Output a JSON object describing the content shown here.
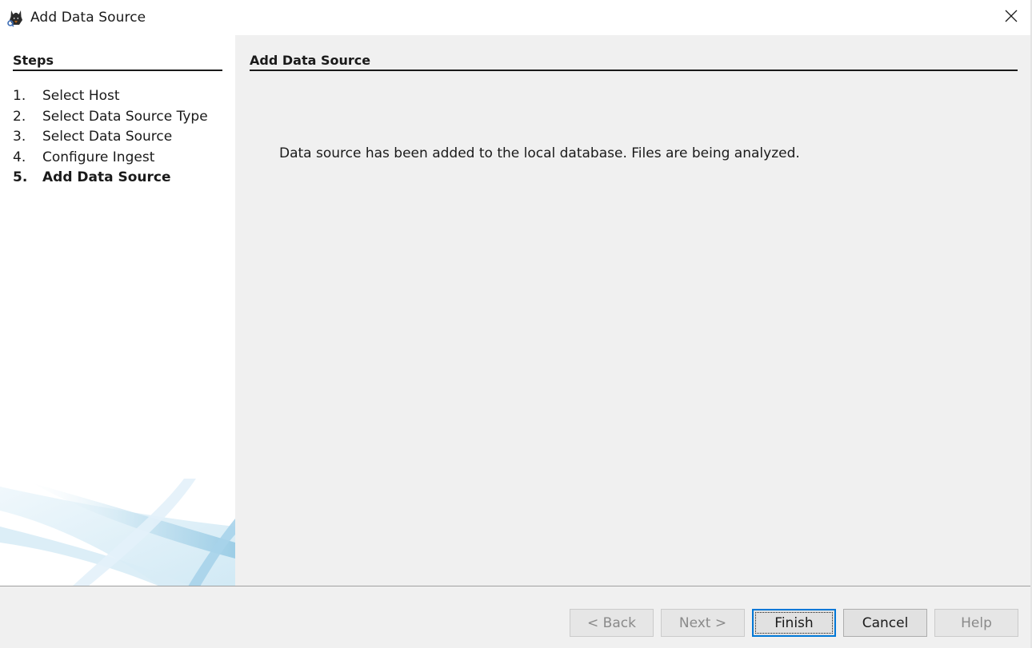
{
  "window": {
    "title": "Add Data Source",
    "icon": "autopsy-dog-icon"
  },
  "steps": {
    "header": "Steps",
    "items": [
      {
        "num": "1.",
        "label": "Select Host",
        "active": false
      },
      {
        "num": "2.",
        "label": "Select Data Source Type",
        "active": false
      },
      {
        "num": "3.",
        "label": "Select Data Source",
        "active": false
      },
      {
        "num": "4.",
        "label": "Configure Ingest",
        "active": false
      },
      {
        "num": "5.",
        "label": "Add Data Source",
        "active": true
      }
    ]
  },
  "content": {
    "header": "Add Data Source",
    "message": "Data source has been added to the local database. Files are being analyzed."
  },
  "buttons": {
    "back": "< Back",
    "next": "Next >",
    "finish": "Finish",
    "cancel": "Cancel",
    "help": "Help"
  },
  "colors": {
    "accent": "#0078d7",
    "panel_bg": "#f0f0f0",
    "steps_bg": "#ffffff",
    "swoosh": "#9fcfe6"
  }
}
